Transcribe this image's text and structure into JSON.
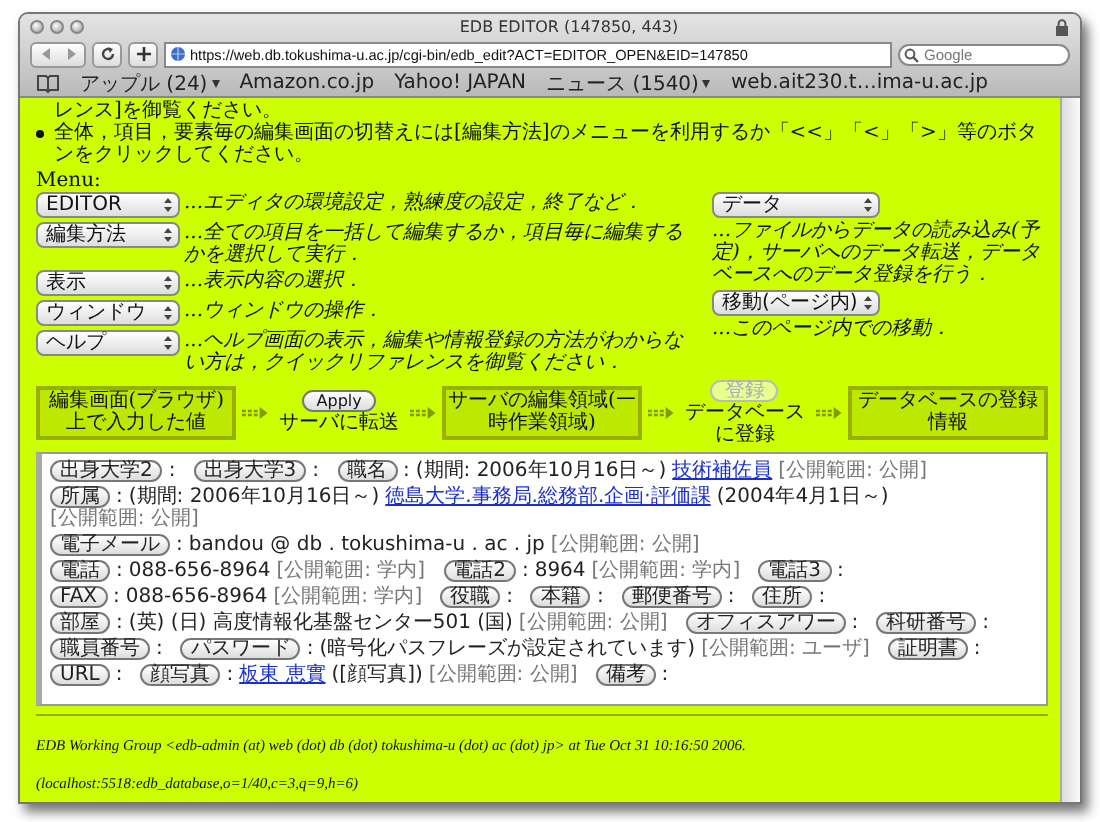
{
  "window": {
    "title": "EDB EDITOR (147850, 443)"
  },
  "address_bar": {
    "value": "https://web.db.tokushima-u.ac.jp/cgi-bin/edb_edit?ACT=EDITOR_OPEN&EID=147850"
  },
  "search": {
    "placeholder": "Google"
  },
  "bookmarks": [
    {
      "label": "アップル (24)",
      "menu": true
    },
    {
      "label": "Amazon.co.jp",
      "menu": false
    },
    {
      "label": "Yahoo! JAPAN",
      "menu": false
    },
    {
      "label": "ニュース (1540)",
      "menu": true
    },
    {
      "label": "web.ait230.t…ima-u.ac.jp",
      "menu": false
    }
  ],
  "notices": [
    {
      "text": "レンス]を御覧ください。",
      "bullet": false
    },
    {
      "text": "全体，項目，要素毎の編集画面の切替えには[編集方法]のメニューを利用するか「<<」「<」「>」等のボタンをクリックしてください。",
      "bullet": true
    }
  ],
  "menu_label": "Menu:",
  "menus_left": [
    {
      "value": "EDITOR",
      "description": "...エディタの環境設定，熟練度の設定，終了など．"
    },
    {
      "value": "編集方法",
      "description": "...全ての項目を一括して編集するか，項目毎に編集するかを選択して実行．"
    },
    {
      "value": "表示",
      "description": "...表示内容の選択．"
    },
    {
      "value": "ウィンドウ",
      "description": "...ウィンドウの操作．"
    },
    {
      "value": "ヘルプ",
      "description": "...ヘルプ画面の表示，編集や情報登録の方法がわからない方は，クイックリファレンスを御覧ください．"
    }
  ],
  "menus_right": [
    {
      "value": "データ",
      "description": "...ファイルからデータの読み込み(予定)，サーバへのデータ転送，データベースへのデータ登録を行う．"
    },
    {
      "value": "移動(ページ内)",
      "description": "...このページ内での移動．"
    }
  ],
  "flow": [
    {
      "kind": "box",
      "text": "編集画面(ブラウザ)上で入力した値"
    },
    {
      "kind": "action",
      "button": "Apply",
      "disabled": false,
      "caption": "サーバに転送"
    },
    {
      "kind": "box",
      "text": "サーバの編集領域(一時作業領域)"
    },
    {
      "kind": "action",
      "button": "登録",
      "disabled": true,
      "caption": "データベースに登録"
    },
    {
      "kind": "box",
      "text": "データベースの登録情報"
    }
  ],
  "fields": [
    {
      "label": "出身大学2",
      "colon": ":"
    },
    {
      "label": "出身大学3",
      "colon": ":"
    },
    {
      "label": "職名",
      "colon": ":",
      "parts": [
        {
          "kind": "text",
          "text": "(期間: 2006年10月16日～)"
        },
        {
          "kind": "link",
          "text": "技術補佐員"
        },
        {
          "kind": "scope",
          "text": "[公開範囲: 公開]"
        }
      ]
    },
    {
      "label": "所属",
      "colon": ":",
      "parts": [
        {
          "kind": "text",
          "text": "(期間: 2006年10月16日～)"
        },
        {
          "kind": "link",
          "text": "徳島大学.事務局.総務部.企画·評価課"
        },
        {
          "kind": "text",
          "text": "(2004年4月1日～)"
        },
        {
          "kind": "scope",
          "text": "[公開範囲: 公開]"
        }
      ]
    },
    {
      "label": "電子メール",
      "colon": ":",
      "parts": [
        {
          "kind": "text",
          "text": "bandou @ db . tokushima-u . ac . jp"
        },
        {
          "kind": "scope",
          "text": "[公開範囲: 公開]"
        }
      ]
    },
    {
      "label": "電話",
      "colon": ":",
      "parts": [
        {
          "kind": "text",
          "text": "088-656-8964"
        },
        {
          "kind": "scope",
          "text": "[公開範囲: 学内]"
        }
      ]
    },
    {
      "label": "電話2",
      "colon": ":",
      "parts": [
        {
          "kind": "text",
          "text": "8964"
        },
        {
          "kind": "scope",
          "text": "[公開範囲: 学内]"
        }
      ]
    },
    {
      "label": "電話3",
      "colon": ":"
    },
    {
      "label": "FAX",
      "colon": ":",
      "parts": [
        {
          "kind": "text",
          "text": "088-656-8964"
        },
        {
          "kind": "scope",
          "text": "[公開範囲: 学内]"
        }
      ]
    },
    {
      "label": "役職",
      "colon": ":"
    },
    {
      "label": "本籍",
      "colon": ":"
    },
    {
      "label": "郵便番号",
      "colon": ":"
    },
    {
      "label": "住所",
      "colon": ":"
    },
    {
      "label": "部屋",
      "colon": ":",
      "parts": [
        {
          "kind": "text",
          "text": "(英) (日) 高度情報化基盤センター501 (国)"
        },
        {
          "kind": "scope",
          "text": "[公開範囲: 公開]"
        }
      ]
    },
    {
      "label": "オフィスアワー",
      "colon": ":"
    },
    {
      "label": "科研番号",
      "colon": ":"
    },
    {
      "label": "職員番号",
      "colon": ":"
    },
    {
      "label": "パスワード",
      "colon": ":",
      "parts": [
        {
          "kind": "text",
          "text": "(暗号化パスフレーズが設定されています)"
        },
        {
          "kind": "scope",
          "text": "[公開範囲: ユーザ]"
        }
      ]
    },
    {
      "label": "証明書",
      "colon": ":"
    },
    {
      "label": "URL",
      "colon": ":"
    },
    {
      "label": "顔写真",
      "colon": ":",
      "parts": [
        {
          "kind": "link",
          "text": "板東 恵實"
        },
        {
          "kind": "text",
          "text": "([顔写真])"
        },
        {
          "kind": "scope",
          "text": "[公開範囲: 公開]"
        }
      ]
    },
    {
      "label": "備考",
      "colon": ":"
    }
  ],
  "footer": "EDB Working Group <edb-admin (at) web (dot) db (dot) tokushima-u (dot) ac (dot) jp> at Tue Oct 31 10:16:50 2006. (localhost:5518:edb_database,o=1/40,c=3,q=9,h=6)"
}
